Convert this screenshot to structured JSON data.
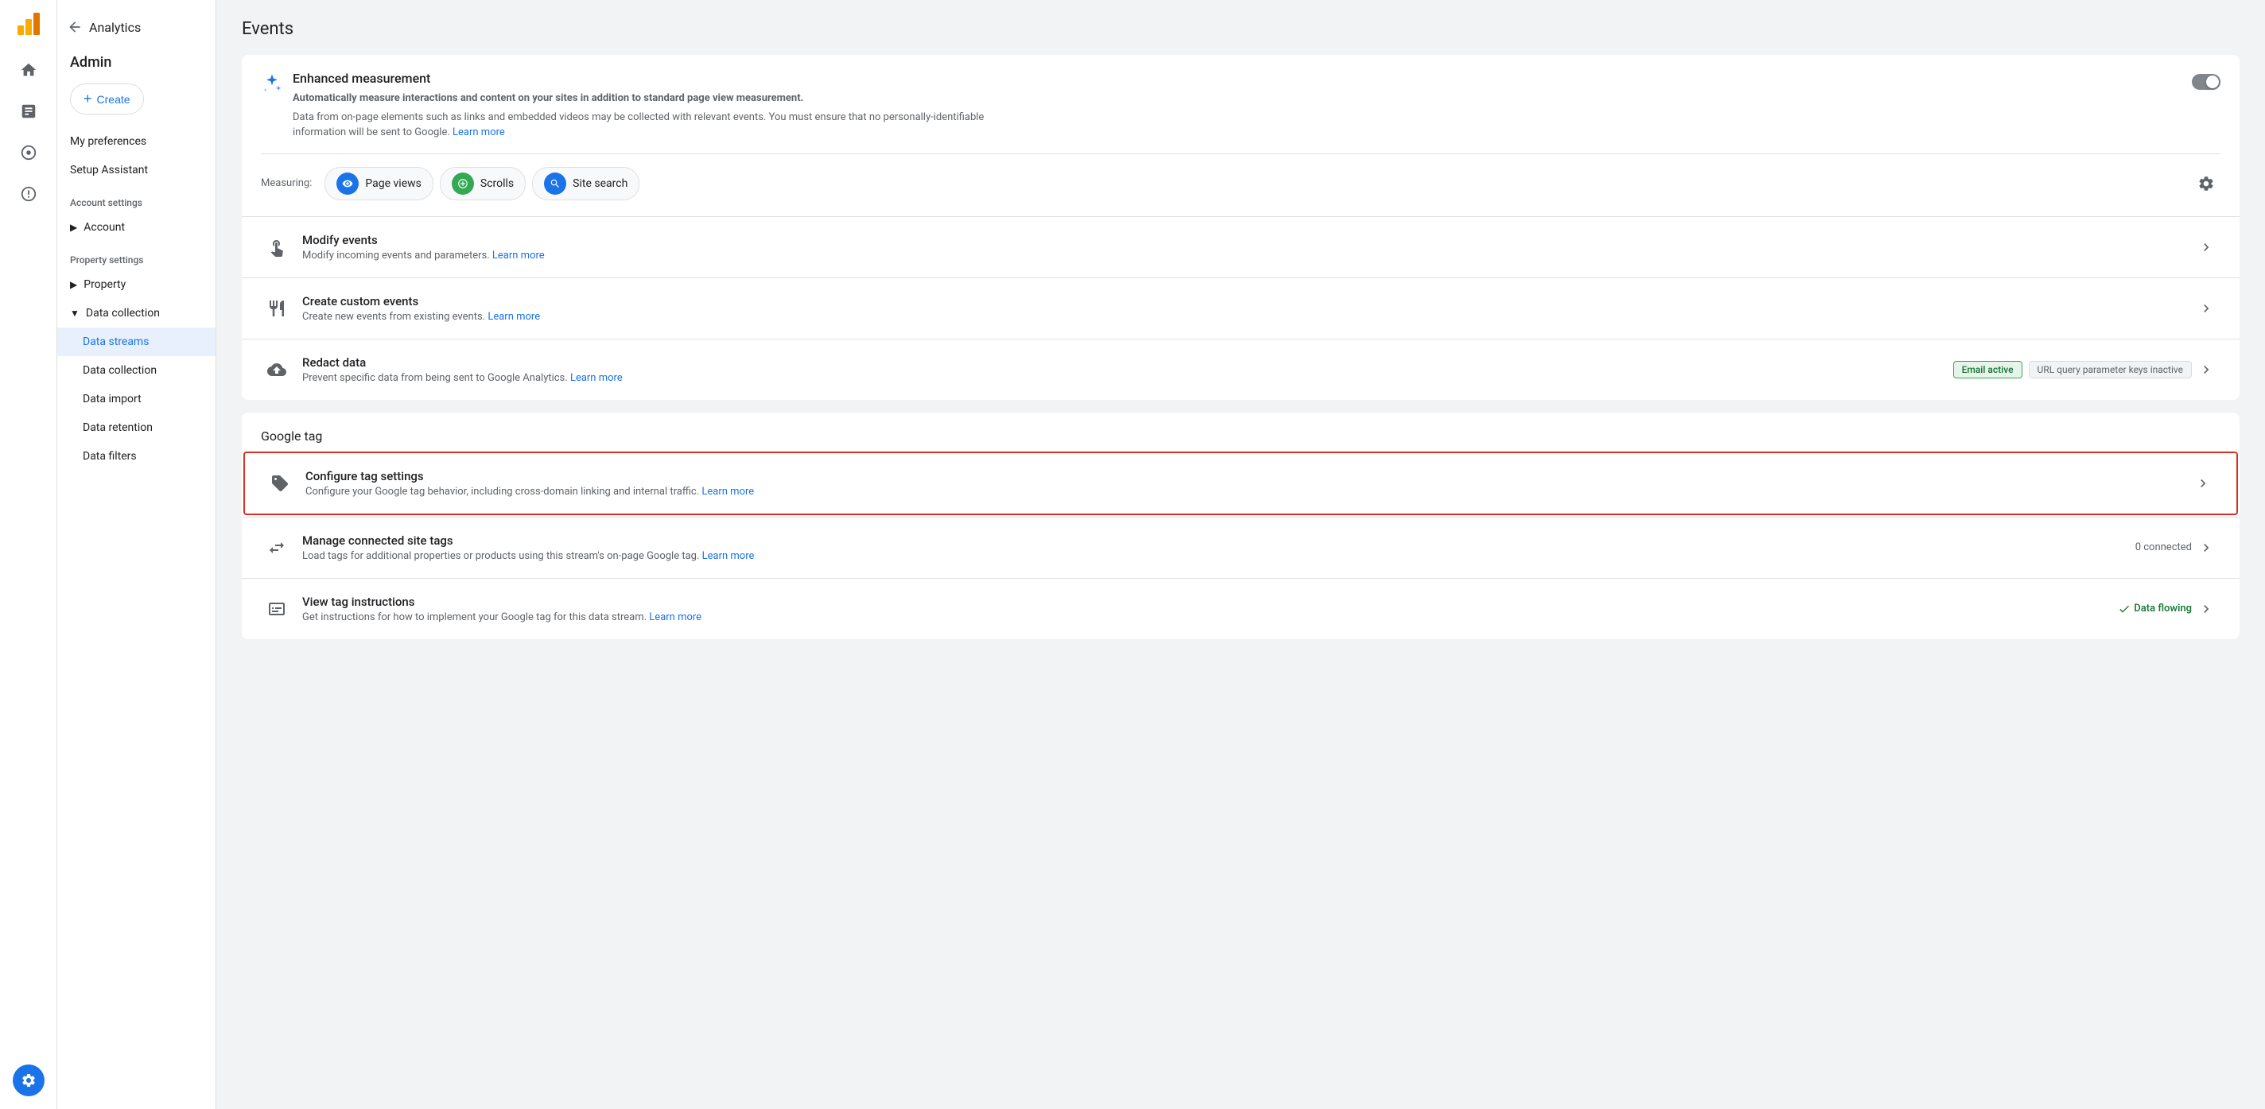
{
  "sidebar": {
    "logo_text": "Analytics",
    "nav_items": [
      {
        "name": "home",
        "icon": "⌂",
        "active": false
      },
      {
        "name": "reports",
        "icon": "▦",
        "active": false
      },
      {
        "name": "explore",
        "icon": "○",
        "active": false
      },
      {
        "name": "advertising",
        "icon": "◎",
        "active": false
      }
    ],
    "settings_icon": "⚙"
  },
  "admin_panel": {
    "back_label": "Analytics",
    "title": "Admin",
    "create_label": "Create",
    "menu_items": [
      {
        "label": "My preferences",
        "sub": false
      },
      {
        "label": "Setup Assistant",
        "sub": false
      }
    ],
    "account_section": "Account settings",
    "account_items": [
      {
        "label": "Account",
        "expanded": false,
        "arrow": "▶"
      }
    ],
    "property_section": "Property settings",
    "property_items": [
      {
        "label": "Property",
        "expanded": false,
        "arrow": "▶"
      },
      {
        "label": "Data collection",
        "expanded": true,
        "arrow": "▼"
      },
      {
        "label": "Data streams",
        "sub": true,
        "active": true
      },
      {
        "label": "Data collection",
        "sub": true,
        "active": false
      },
      {
        "label": "Data import",
        "sub": true,
        "active": false
      },
      {
        "label": "Data retention",
        "sub": true,
        "active": false
      },
      {
        "label": "Data filters",
        "sub": true,
        "active": false
      }
    ]
  },
  "main": {
    "page_title": "Events",
    "enhanced_measurement": {
      "icon": "✦",
      "title": "Enhanced measurement",
      "description_line1": "Automatically measure interactions and content on your sites in addition to standard page view measurement.",
      "description_line2": "Data from on-page elements such as links and embedded videos may be collected with relevant events. You must ensure that no personally-identifiable information will be sent to Google.",
      "learn_more_label": "Learn more",
      "toggle_on": false,
      "measuring_label": "Measuring:",
      "pills": [
        {
          "label": "Page views",
          "icon": "👁",
          "icon_color": "blue"
        },
        {
          "label": "Scrolls",
          "icon": "⊕",
          "icon_color": "green"
        },
        {
          "label": "Site search",
          "icon": "🔍",
          "icon_color": "blue"
        }
      ],
      "gear_icon": "⚙"
    },
    "event_rows": [
      {
        "icon": "☞",
        "title": "Modify events",
        "description": "Modify incoming events and parameters.",
        "learn_more_label": "Learn more",
        "badge": null,
        "badge2": null,
        "extra": null
      },
      {
        "icon": "✳",
        "title": "Create custom events",
        "description": "Create new events from existing events.",
        "learn_more_label": "Learn more",
        "badge": null,
        "badge2": null,
        "extra": null
      },
      {
        "icon": "◇",
        "title": "Redact data",
        "description": "Prevent specific data from being sent to Google Analytics.",
        "learn_more_label": "Learn more",
        "badge": "Email active",
        "badge2": "URL query parameter keys inactive",
        "extra": null
      }
    ],
    "google_tag": {
      "title": "Google tag",
      "rows": [
        {
          "icon": "🏷",
          "title": "Configure tag settings",
          "description": "Configure your Google tag behavior, including cross-domain linking and internal traffic.",
          "learn_more_label": "Learn more",
          "extra": null,
          "highlighted": true
        },
        {
          "icon": "⟺",
          "title": "Manage connected site tags",
          "description": "Load tags for additional properties or products using this stream's on-page Google tag.",
          "learn_more_label": "Learn more",
          "extra": "0 connected",
          "highlighted": false
        },
        {
          "icon": "◫",
          "title": "View tag instructions",
          "description": "Get instructions for how to implement your Google tag for this data stream.",
          "learn_more_label": "Learn more",
          "extra": "data_flowing",
          "highlighted": false
        }
      ]
    }
  }
}
